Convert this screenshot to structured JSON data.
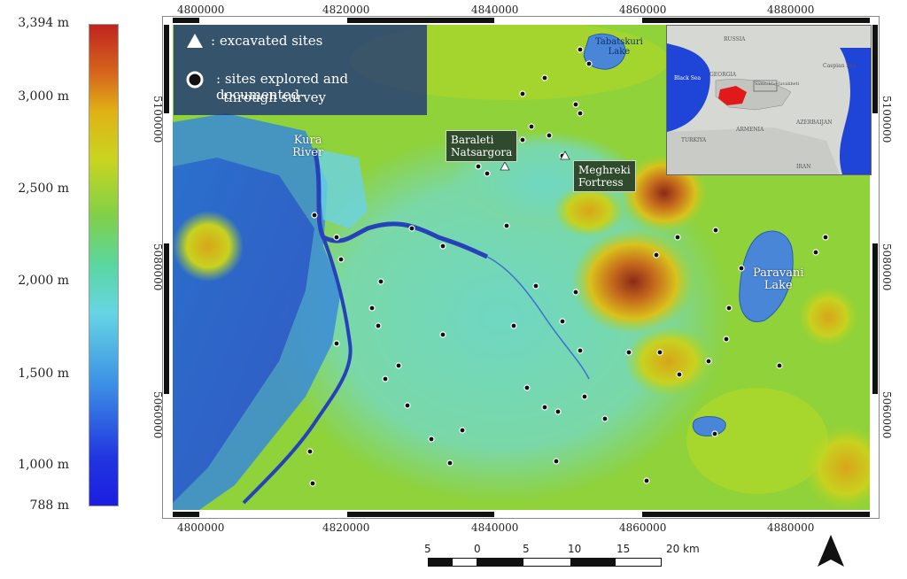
{
  "legend": {
    "labels": [
      "3,394 m",
      "3,000 m",
      "2,500 m",
      "2,000 m",
      "1,500 m",
      "1,000 m",
      "788 m"
    ]
  },
  "axes": {
    "x_ticks": [
      "4800000",
      "4820000",
      "4840000",
      "4860000",
      "4880000"
    ],
    "y_ticks": [
      "5100000",
      "5080000",
      "5060000"
    ]
  },
  "key": {
    "excavated": ": excavated sites",
    "surveyed_line1": ": sites explored and documented",
    "surveyed_line2": "through survey"
  },
  "labels": {
    "kura_line1": "Kura",
    "kura_line2": "River",
    "tabatskuri_line1": "Tabatskuri",
    "tabatskuri_line2": "Lake",
    "paravani_line1": "Paravani",
    "paravani_line2": "Lake",
    "baraleti_line1": "Baraleti",
    "baraleti_line2": "Natsargora",
    "meghreki_line1": "Meghreki",
    "meghreki_line2": "Fortress"
  },
  "inset": {
    "russia": "RUSSIA",
    "georgia": "GEORGIA",
    "black_sea": "Black Sea",
    "caspian_sea": "Caspian Sea",
    "turkey": "TURKIYA",
    "armenia": "ARMENIA",
    "azerbaijan": "AZERBAIJAN",
    "iran": "IRAN",
    "region": "Samtskhe-Javakheti"
  },
  "scalebar": {
    "labels": [
      "5",
      "0",
      "5",
      "10",
      "15",
      "20 km"
    ]
  },
  "colors": {
    "low": "#1b1ee0",
    "mid": "#66d5e4",
    "high": "#c0241e",
    "water": "#4a86d8",
    "region_highlight": "#e0191a"
  },
  "icons": {
    "excavated": "white-triangle",
    "surveyed": "black-circle-white-outline",
    "north": "north-arrow"
  }
}
